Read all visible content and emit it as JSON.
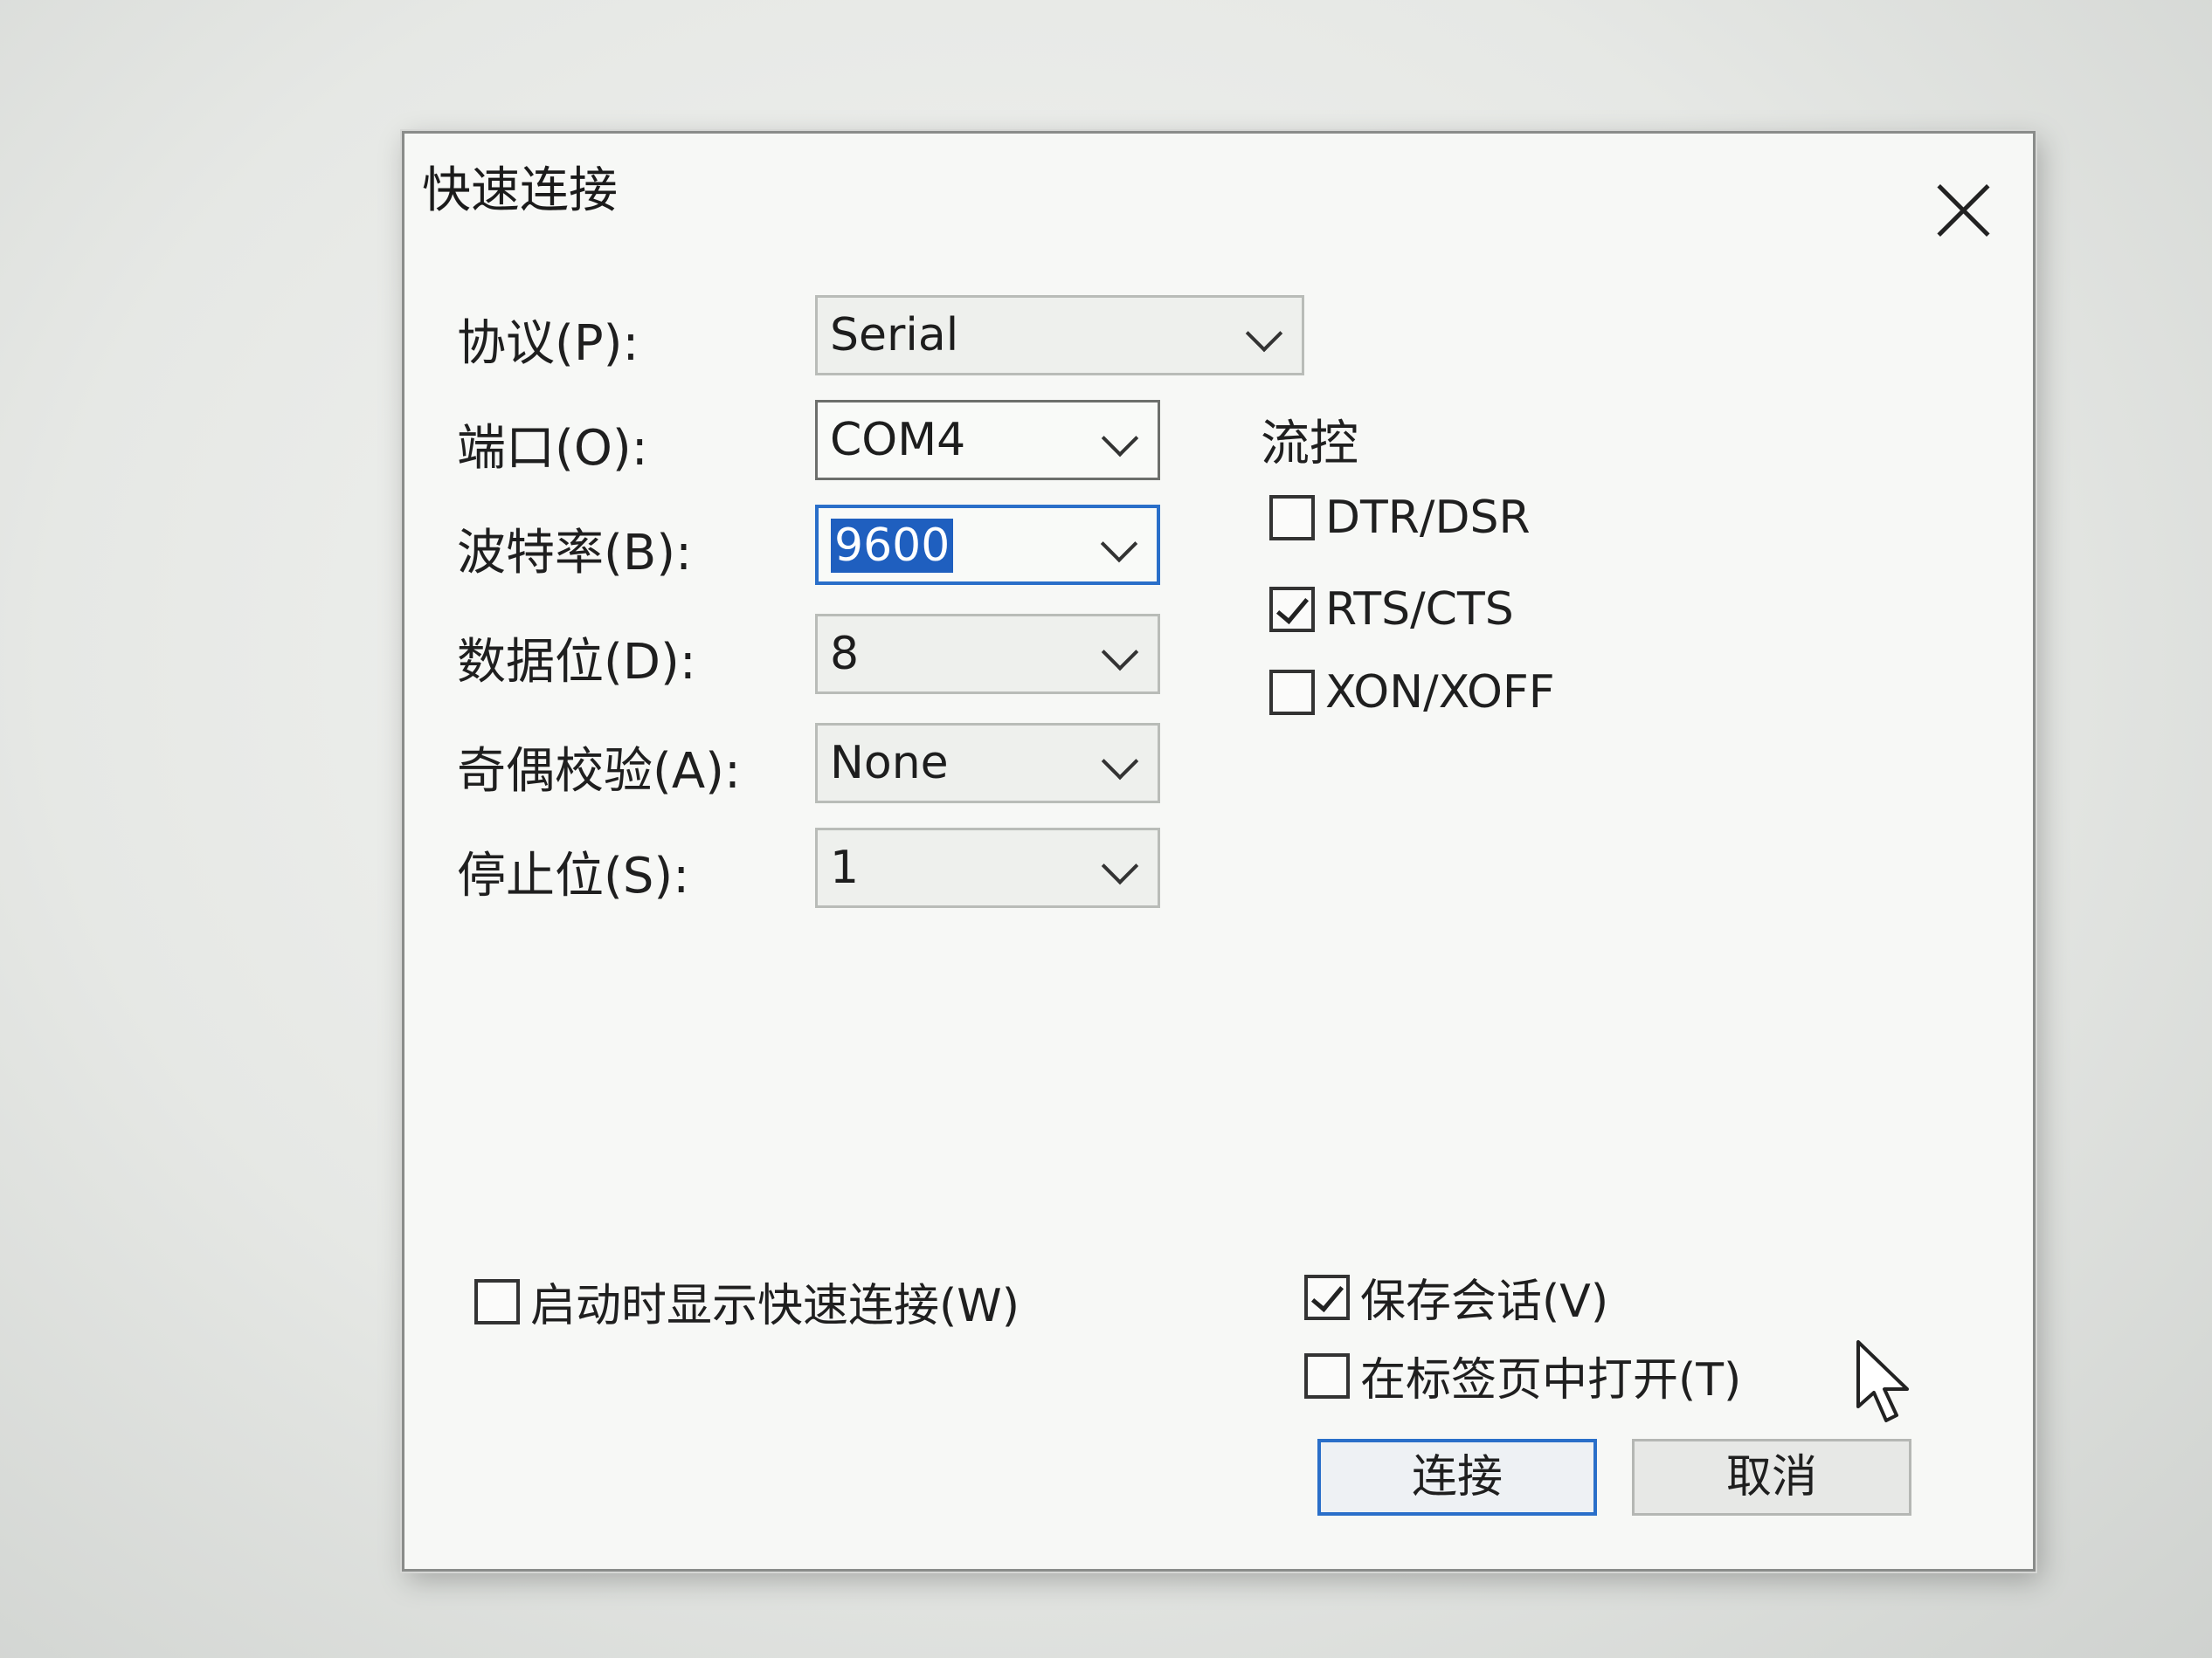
{
  "dialog": {
    "title": "快速连接",
    "close_icon": "close-icon"
  },
  "form": {
    "protocol": {
      "label": "协议(P):",
      "value": "Serial"
    },
    "port": {
      "label": "端口(O):",
      "value": "COM4"
    },
    "baud": {
      "label": "波特率(B):",
      "value": "9600"
    },
    "data_bits": {
      "label": "数据位(D):",
      "value": "8"
    },
    "parity": {
      "label": "奇偶校验(A):",
      "value": "None"
    },
    "stop_bits": {
      "label": "停止位(S):",
      "value": "1"
    }
  },
  "flow_control": {
    "title": "流控",
    "options": [
      {
        "label": "DTR/DSR",
        "checked": false
      },
      {
        "label": "RTS/CTS",
        "checked": true
      },
      {
        "label": "XON/XOFF",
        "checked": false
      }
    ]
  },
  "options": {
    "show_on_startup": {
      "label": "启动时显示快速连接(W)",
      "checked": false
    },
    "save_session": {
      "label": "保存会话(V)",
      "checked": true
    },
    "open_in_tab": {
      "label": "在标签页中打开(T)",
      "checked": false
    }
  },
  "buttons": {
    "connect": "连接",
    "cancel": "取消"
  },
  "colors": {
    "focus_accent": "#2a6fc9",
    "selection": "#1f5fbf"
  }
}
